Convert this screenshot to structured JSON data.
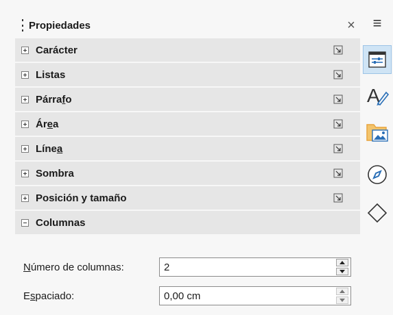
{
  "deck": {
    "title": "Propiedades",
    "close_glyph": "×"
  },
  "panels": [
    {
      "label_pre": "Carácter",
      "label_u": "",
      "label_post": "",
      "expanded": false
    },
    {
      "label_pre": "Listas",
      "label_u": "",
      "label_post": "",
      "expanded": false
    },
    {
      "label_pre": "Párra",
      "label_u": "f",
      "label_post": "o",
      "expanded": false
    },
    {
      "label_pre": "Ár",
      "label_u": "e",
      "label_post": "a",
      "expanded": false
    },
    {
      "label_pre": "Líne",
      "label_u": "a",
      "label_post": "",
      "expanded": false
    },
    {
      "label_pre": "Sombra",
      "label_u": "",
      "label_post": "",
      "expanded": false
    },
    {
      "label_pre": "Posición y tamaño",
      "label_u": "",
      "label_post": "",
      "expanded": false
    },
    {
      "label_pre": "Columnas",
      "label_u": "",
      "label_post": "",
      "expanded": true
    }
  ],
  "columns": {
    "number_label_u": "N",
    "number_label_rest": "úmero de columnas:",
    "number_value": "2",
    "spacing_label_pre": "E",
    "spacing_label_u": "s",
    "spacing_label_rest": "paciado:",
    "spacing_value": "0,00 cm"
  },
  "tabbar": {
    "menu_glyph": "≡",
    "tabs": [
      "properties-icon",
      "styles-icon",
      "gallery-icon",
      "navigator-icon",
      "shapes-icon"
    ],
    "selected": "properties-icon"
  },
  "colors": {
    "panel_bg": "#e6e6e6",
    "selected_tab": "#cfe4f5",
    "accent_blue": "#2a6fb7",
    "folder_orange": "#e8a33d"
  }
}
